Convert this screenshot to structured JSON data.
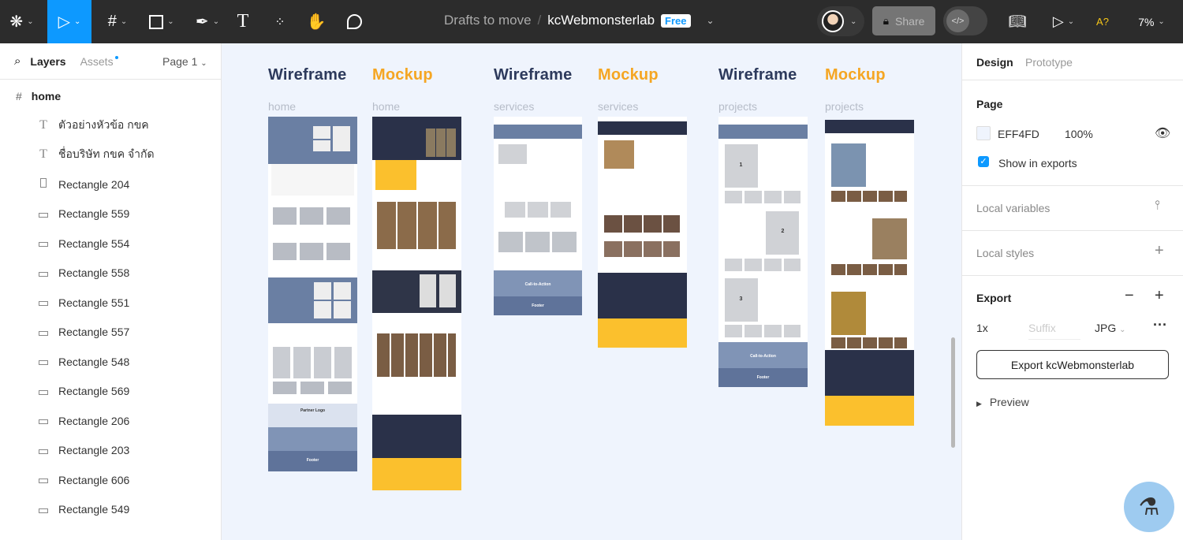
{
  "toolbar": {
    "file_path": "Drafts to move",
    "separator": "/",
    "file_name": "kcWebmonsterlab",
    "plan_badge": "Free",
    "share_label": "Share",
    "zoom": "7%",
    "accessibility_label": "A?"
  },
  "left_panel": {
    "tabs": [
      "Layers",
      "Assets"
    ],
    "page_selector": "Page 1",
    "frame": "home",
    "layers": [
      {
        "type": "text",
        "label": "ตัวอย่างหัวข้อ กขค"
      },
      {
        "type": "text",
        "label": "ชื่อบริษัท กขค จำกัด"
      },
      {
        "type": "rect-vertical",
        "label": "Rectangle 204"
      },
      {
        "type": "rect",
        "label": "Rectangle 559"
      },
      {
        "type": "rect",
        "label": "Rectangle 554"
      },
      {
        "type": "rect",
        "label": "Rectangle 558"
      },
      {
        "type": "rect",
        "label": "Rectangle 551"
      },
      {
        "type": "rect",
        "label": "Rectangle 557"
      },
      {
        "type": "rect",
        "label": "Rectangle 548"
      },
      {
        "type": "rect",
        "label": "Rectangle 569"
      },
      {
        "type": "rect",
        "label": "Rectangle 206"
      },
      {
        "type": "rect",
        "label": "Rectangle 203"
      },
      {
        "type": "rect",
        "label": "Rectangle 606"
      },
      {
        "type": "rect",
        "label": "Rectangle 549"
      }
    ]
  },
  "canvas": {
    "background": "#EFF4FD",
    "groups": [
      {
        "wireframe": "Wireframe",
        "mockup": "Mockup",
        "page": "home"
      },
      {
        "wireframe": "Wireframe",
        "mockup": "Mockup",
        "page": "services"
      },
      {
        "wireframe": "Wireframe",
        "mockup": "Mockup",
        "page": "projects"
      }
    ],
    "frame_text": {
      "cta": "Call-to-Action",
      "footer": "Footer",
      "partner": "Partner Logo",
      "n1": "1",
      "n2": "2",
      "n3": "3"
    }
  },
  "right_panel": {
    "tabs": [
      "Design",
      "Prototype"
    ],
    "page_title": "Page",
    "page_color": "EFF4FD",
    "page_opacity": "100%",
    "show_in_exports": "Show in exports",
    "show_in_exports_checked": true,
    "local_variables": "Local variables",
    "local_styles": "Local styles",
    "export_title": "Export",
    "export_scale": "1x",
    "suffix_placeholder": "Suffix",
    "format": "JPG",
    "export_button": "Export kcWebmonsterlab",
    "preview": "Preview"
  }
}
